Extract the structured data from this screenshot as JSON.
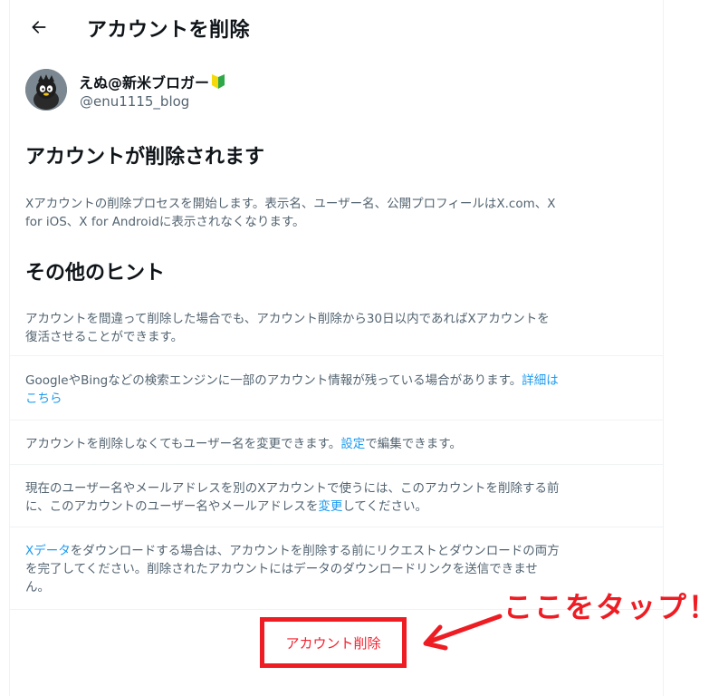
{
  "header": {
    "back_icon": "arrow-left-icon",
    "title": "アカウントを削除"
  },
  "user": {
    "name": "えぬ@新米ブロガー",
    "badge_icon": "beginner-mark-icon",
    "handle": "@enu1115_blog"
  },
  "section1": {
    "heading": "アカウントが削除されます",
    "line1": "Xアカウントの削除プロセスを開始します。表示名、ユーザー名、公開プロフィールはX.com、X",
    "line2": "for iOS、X for Androidに表示されなくなります。"
  },
  "section2": {
    "heading": "その他のヒント"
  },
  "tips": {
    "t1": {
      "line1": "アカウントを間違って削除した場合でも、アカウント削除から30日以内であればXアカウントを",
      "line2": "復活させることができます。"
    },
    "t2": {
      "line1": "GoogleやBingなどの検索エンジンに一部のアカウント情報が残っている場合があります。",
      "link1": "詳細は",
      "link2": "こちら"
    },
    "t3": {
      "before": "アカウントを削除しなくてもユーザー名を変更できます。",
      "link": "設定",
      "after": "で編集できます。"
    },
    "t4": {
      "line1": "現在のユーザー名やメールアドレスを別のXアカウントで使うには、このアカウントを削除する前",
      "line2_before": "に、このアカウントのユーザー名やメールアドレスを",
      "link": "変更",
      "line2_after": "してください。"
    },
    "t5": {
      "link": "Xデータ",
      "line1_after": "をダウンロードする場合は、アカウントを削除する前にリクエストとダウンロードの両方",
      "line2": "を完了してください。削除されたアカウントにはデータのダウンロードリンクを送信できませ",
      "line3": "ん。"
    }
  },
  "action": {
    "delete_label": "アカウント削除"
  },
  "annotation": {
    "callout": "ここをタップ！",
    "highlight_color": "#ee1c23"
  }
}
